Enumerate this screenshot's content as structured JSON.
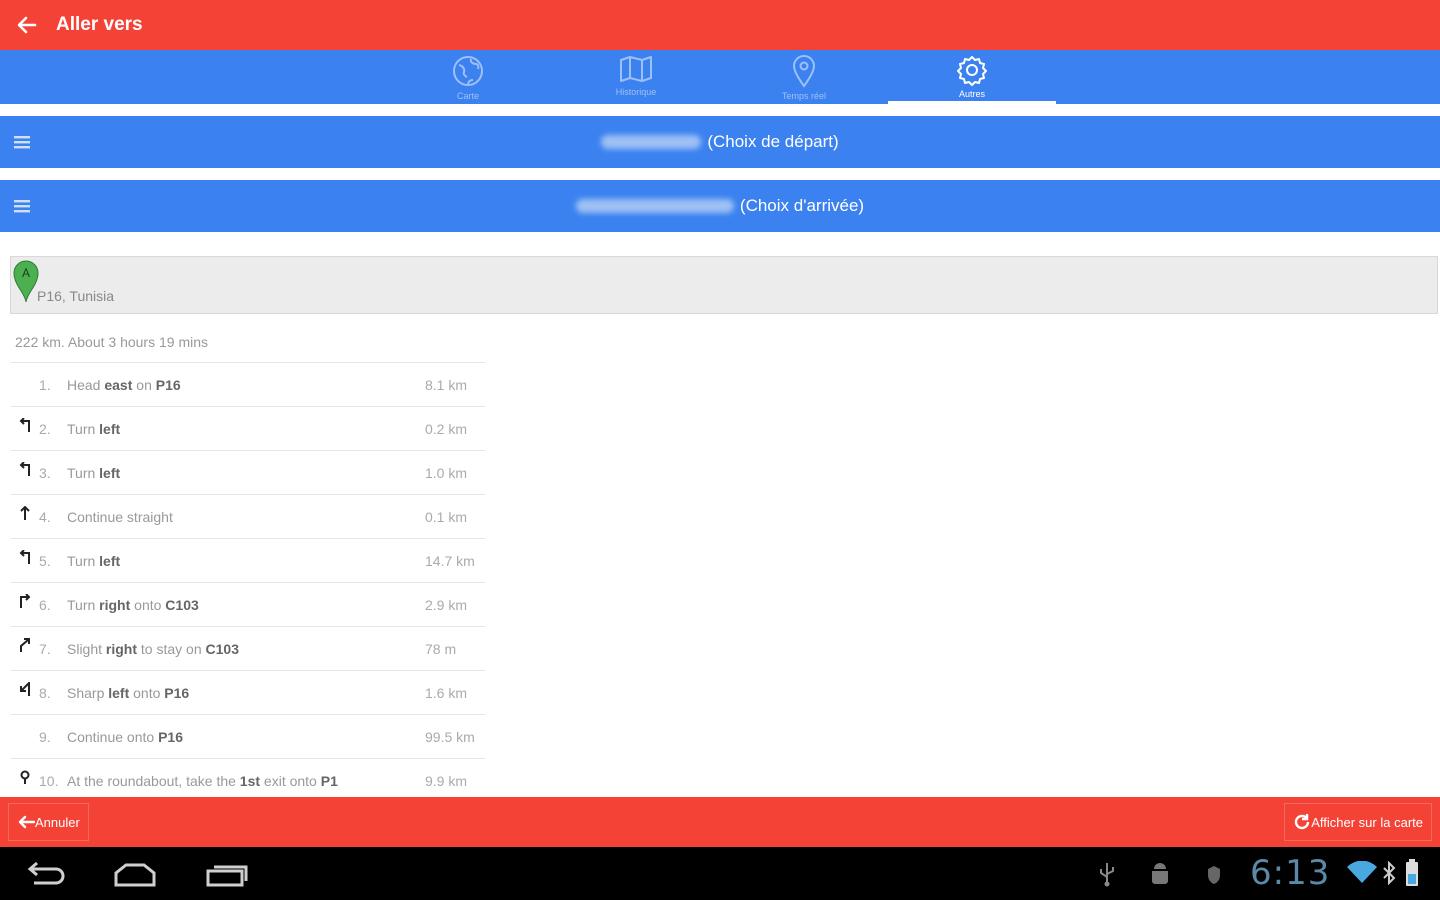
{
  "appbar": {
    "title": "Aller vers"
  },
  "tabs": [
    {
      "label": "Carte",
      "icon": "globe-icon",
      "active": false
    },
    {
      "label": "Historique",
      "icon": "map-icon",
      "active": false
    },
    {
      "label": "Temps réel",
      "icon": "location-pin-icon",
      "active": false
    },
    {
      "label": "Autres",
      "icon": "gear-icon",
      "active": true
    }
  ],
  "departure": {
    "label": "(Choix de départ)"
  },
  "arrival": {
    "label": "(Choix d'arrivée)"
  },
  "origin": {
    "marker": "A",
    "address": "P16, Tunisia"
  },
  "summary": "222 km. About 3 hours 19 mins",
  "steps": [
    {
      "num": "1.",
      "pre": "Head ",
      "b1": "east",
      "mid": " on ",
      "b2": "P16",
      "dist": "8.1 km",
      "icon": "none"
    },
    {
      "num": "2.",
      "pre": "Turn ",
      "b1": "left",
      "mid": "",
      "b2": "",
      "dist": "0.2 km",
      "icon": "turn-left-icon"
    },
    {
      "num": "3.",
      "pre": "Turn ",
      "b1": "left",
      "mid": "",
      "b2": "",
      "dist": "1.0 km",
      "icon": "turn-left-icon"
    },
    {
      "num": "4.",
      "pre": "Continue straight",
      "b1": "",
      "mid": "",
      "b2": "",
      "dist": "0.1 km",
      "icon": "straight-icon"
    },
    {
      "num": "5.",
      "pre": "Turn ",
      "b1": "left",
      "mid": "",
      "b2": "",
      "dist": "14.7 km",
      "icon": "turn-left-icon"
    },
    {
      "num": "6.",
      "pre": "Turn ",
      "b1": "right",
      "mid": " onto ",
      "b2": "C103",
      "dist": "2.9 km",
      "icon": "turn-right-icon"
    },
    {
      "num": "7.",
      "pre": "Slight ",
      "b1": "right",
      "mid": " to stay on ",
      "b2": "C103",
      "dist": "78 m",
      "icon": "slight-right-icon"
    },
    {
      "num": "8.",
      "pre": "Sharp ",
      "b1": "left",
      "mid": " onto ",
      "b2": "P16",
      "dist": "1.6 km",
      "icon": "sharp-left-icon"
    },
    {
      "num": "9.",
      "pre": "Continue onto ",
      "b1": "P16",
      "mid": "",
      "b2": "",
      "dist": "99.5 km",
      "icon": "none"
    },
    {
      "num": "10.",
      "pre": "At the roundabout, take the ",
      "b1": "1st",
      "mid": " exit onto ",
      "b2": "P1",
      "dist": "9.9 km",
      "icon": "roundabout-icon"
    }
  ],
  "bottombar": {
    "cancel_label": "Annuler",
    "show_map_label": "Afficher sur la carte"
  },
  "statusbar": {
    "time": "6:13"
  },
  "colors": {
    "primary_red": "#f44336",
    "primary_blue": "#3b82f0",
    "marker_green": "#4caf50"
  }
}
